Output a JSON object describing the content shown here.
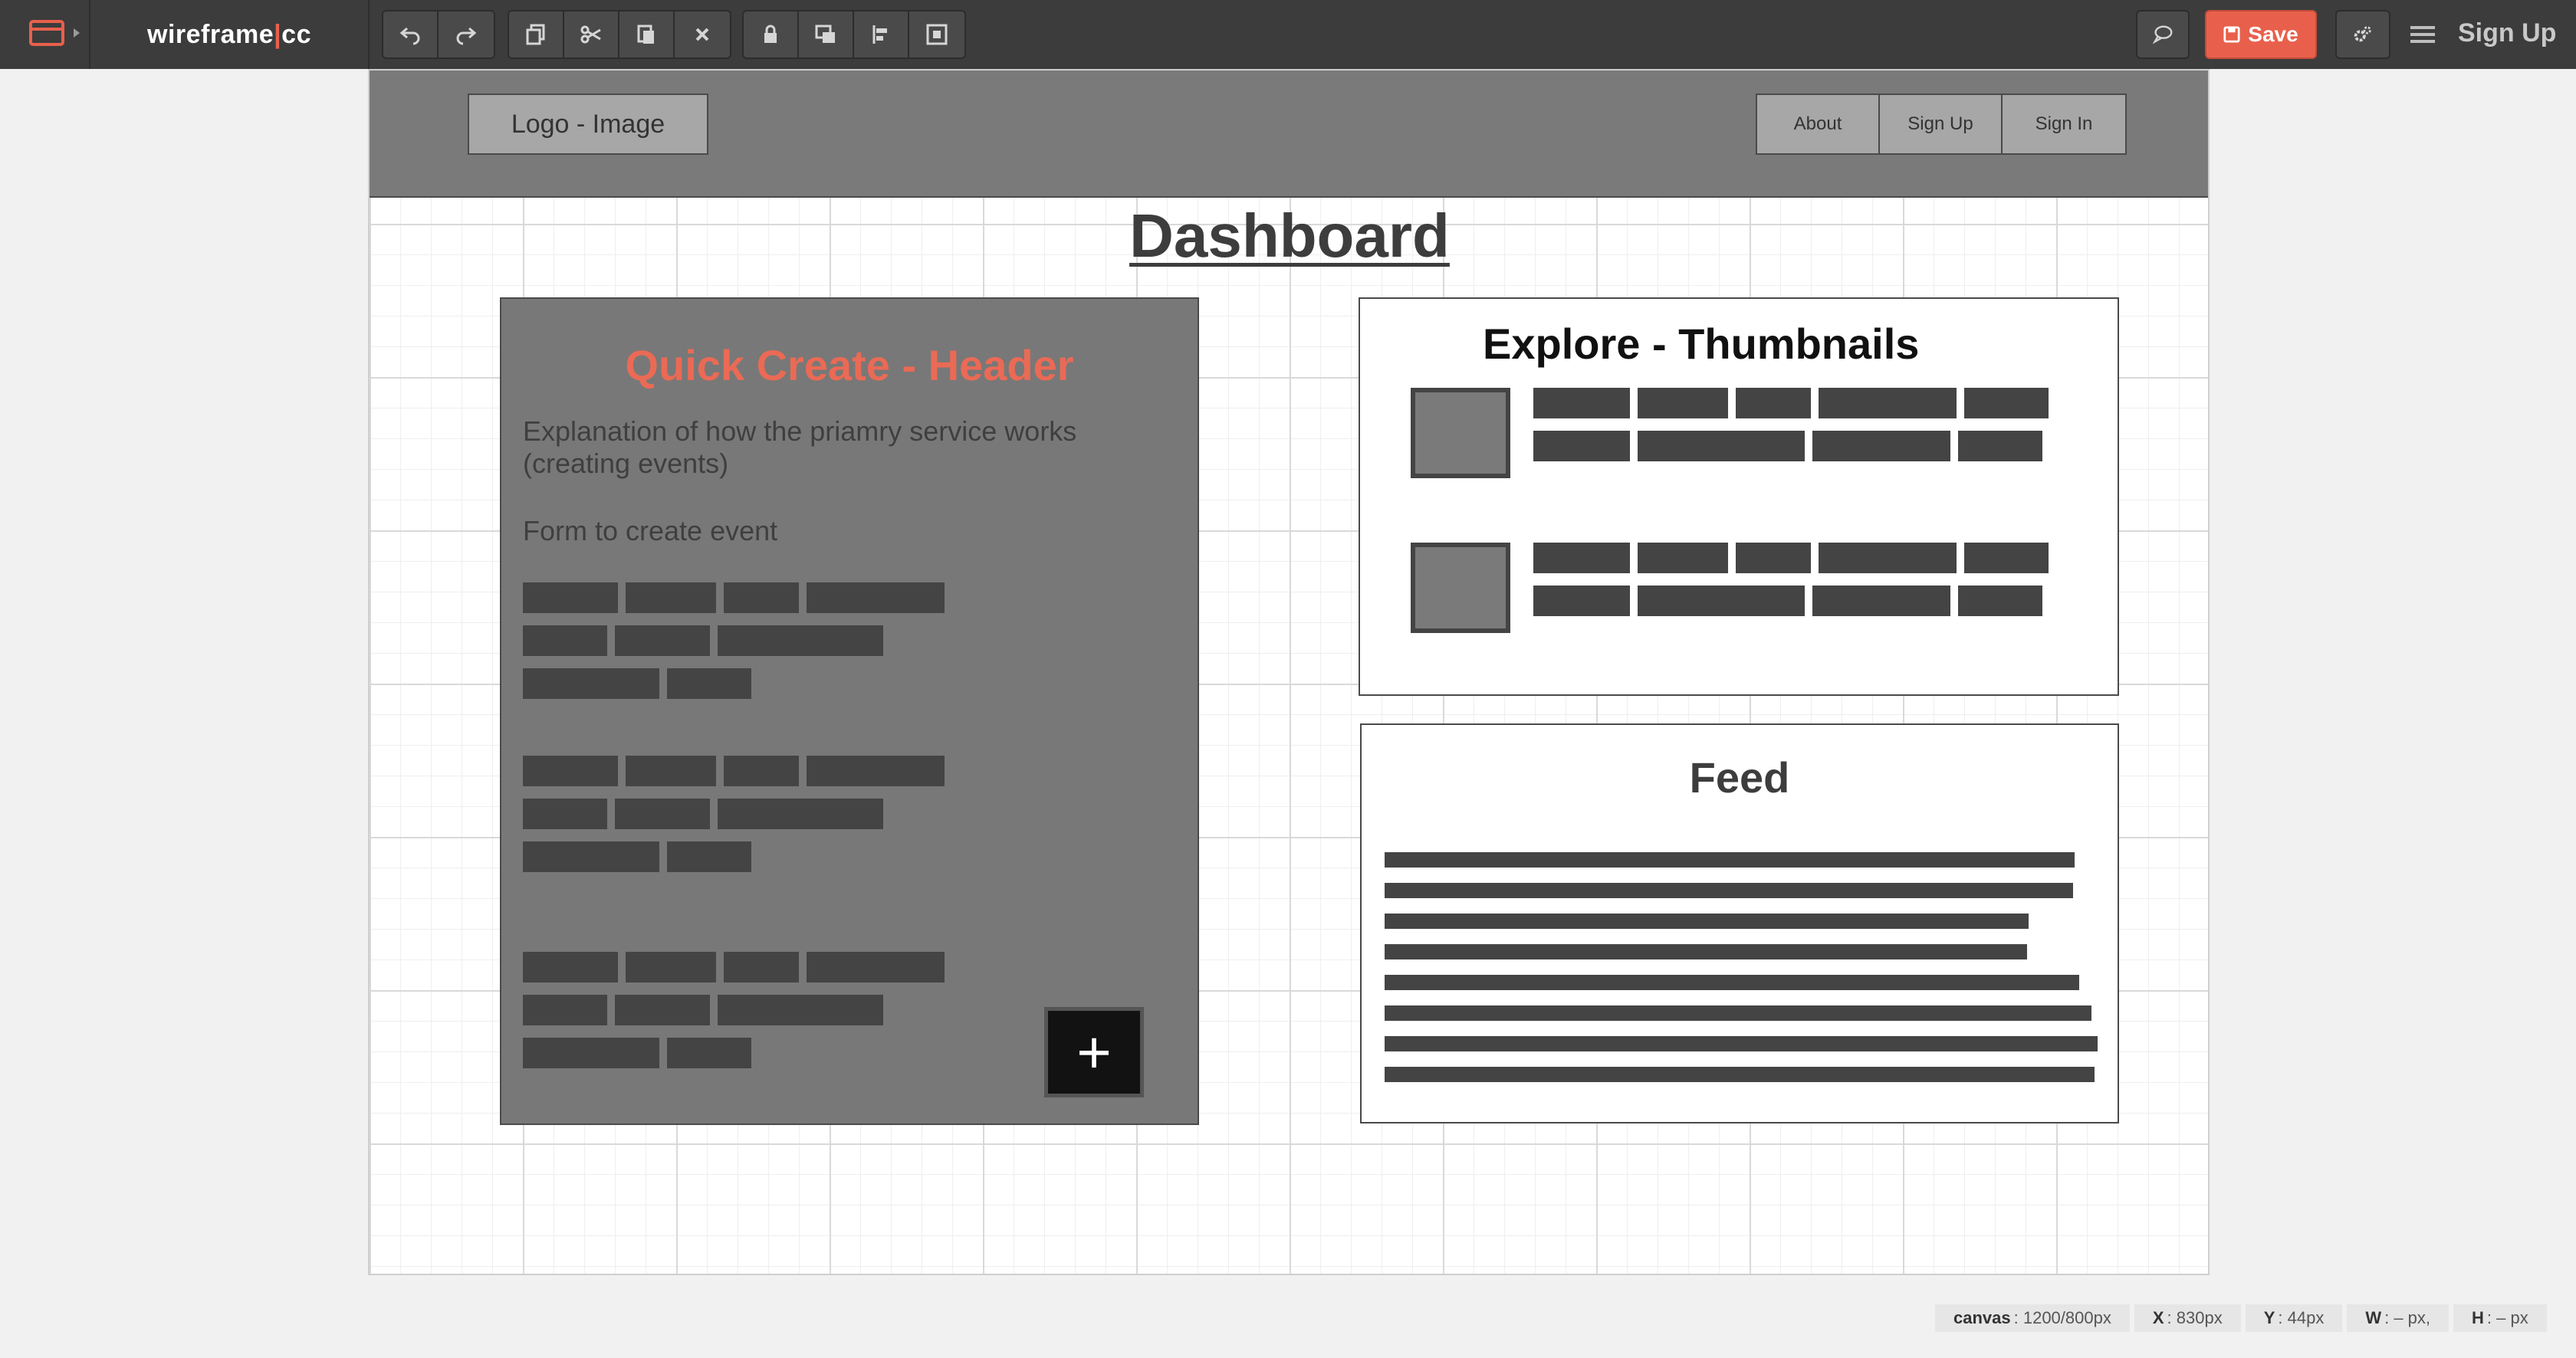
{
  "toolbar": {
    "logo_left": "wireframe",
    "logo_sep": "|",
    "logo_right": "cc",
    "save_label": "Save",
    "signup_label": "Sign Up",
    "icons": [
      "frame-icon",
      "undo-icon",
      "redo-icon",
      "copy-icon",
      "cut-icon",
      "paste-icon",
      "delete-icon",
      "lock-icon",
      "arrange-icon",
      "align-icon",
      "group-icon",
      "comment-icon",
      "save-icon",
      "settings-icon",
      "menu-icon"
    ]
  },
  "wireframe": {
    "logo_box": "Logo - Image",
    "nav": [
      "About",
      "Sign Up",
      "Sign In"
    ],
    "title": "Dashboard",
    "quick_create": {
      "title": "Quick Create - Header",
      "description": "Explanation of how the priamry service works (creating events)",
      "form_label": "Form to create event",
      "button": "+"
    },
    "explore": {
      "title": "Explore - Thumbnails"
    },
    "feed": {
      "title": "Feed"
    }
  },
  "status": {
    "canvas_label": "canvas",
    "canvas_value": ": 1200/800px",
    "x_label": "X",
    "x_value": ": 830px",
    "y_label": "Y",
    "y_value": ": 44px",
    "w_label": "W",
    "w_value": ": – px,",
    "h_label": "H",
    "h_value": ": – px"
  },
  "colors": {
    "accent": "#e8604c",
    "toolbar_bg": "#3c3c3c",
    "header_gray": "#7a7a7a",
    "placeholder_block": "#444444"
  }
}
